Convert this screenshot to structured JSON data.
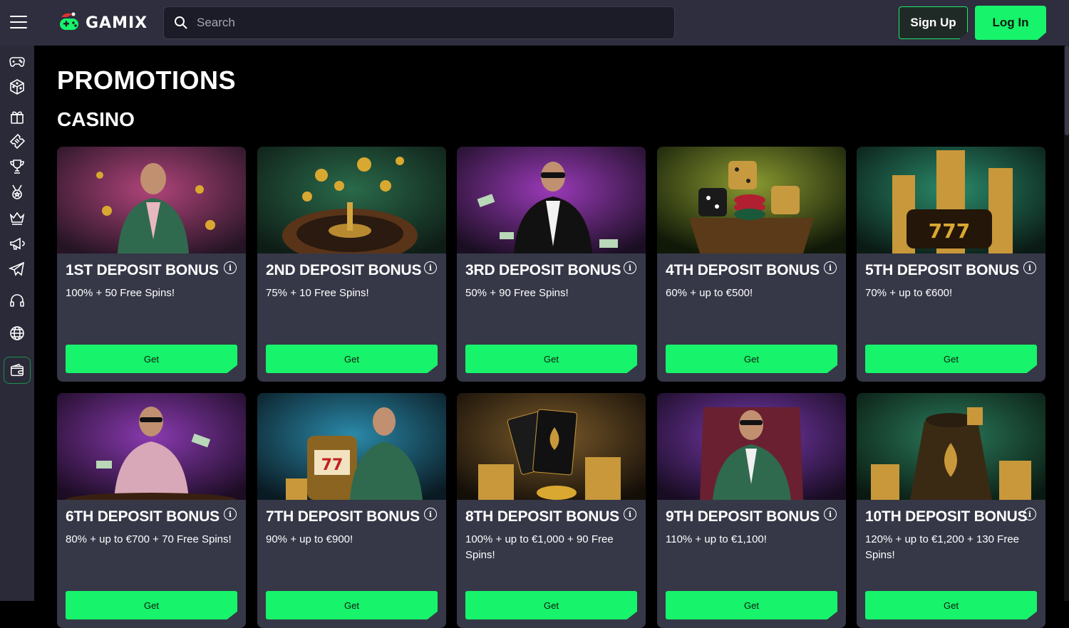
{
  "header": {
    "menu_icon": "hamburger-icon",
    "logo_text": "GAMIX",
    "search_placeholder": "Search",
    "signup_label": "Sign Up",
    "login_label": "Log In"
  },
  "sidebar": {
    "items": [
      {
        "icon": "gamepad-icon"
      },
      {
        "icon": "dice-icon"
      },
      {
        "icon": "gift-icon"
      },
      {
        "icon": "ticket-icon"
      },
      {
        "icon": "trophy-icon"
      },
      {
        "icon": "medal-icon"
      },
      {
        "icon": "crown-icon"
      },
      {
        "icon": "megaphone-icon"
      },
      {
        "icon": "telegram-icon"
      },
      {
        "icon": "headset-icon"
      },
      {
        "icon": "globe-icon"
      },
      {
        "icon": "wallet-icon"
      }
    ]
  },
  "page": {
    "title": "PROMOTIONS",
    "section": "CASINO"
  },
  "colors": {
    "accent": "#17f36a",
    "card_bg": "#363848",
    "topbar_bg": "#2e2e3e"
  },
  "promotions": [
    {
      "title": "1ST DEPOSIT BONUS",
      "desc": "100% + 50 Free Spins!",
      "button": "Get"
    },
    {
      "title": "2ND DEPOSIT BONUS",
      "desc": "75% + 10 Free Spins!",
      "button": "Get"
    },
    {
      "title": "3RD DEPOSIT BONUS",
      "desc": "50% + 90 Free Spins!",
      "button": "Get"
    },
    {
      "title": "4TH DEPOSIT BONUS",
      "desc": "60% + up to €500!",
      "button": "Get"
    },
    {
      "title": "5TH DEPOSIT BONUS",
      "desc": "70% + up to €600!",
      "button": "Get"
    },
    {
      "title": "6TH DEPOSIT BONUS",
      "desc": "80% + up to €700 + 70 Free Spins!",
      "button": "Get"
    },
    {
      "title": "7TH DEPOSIT BONUS",
      "desc": "90% + up to €900!",
      "button": "Get"
    },
    {
      "title": "8TH DEPOSIT BONUS",
      "desc": "100% + up to €1,000 + 90 Free Spins!",
      "button": "Get"
    },
    {
      "title": "9TH DEPOSIT BONUS",
      "desc": "110% + up to €1,100!",
      "button": "Get"
    },
    {
      "title": "10TH DEPOSIT BONUS",
      "desc": "120% + up to €1,200 + 130 Free Spins!",
      "button": "Get"
    }
  ]
}
